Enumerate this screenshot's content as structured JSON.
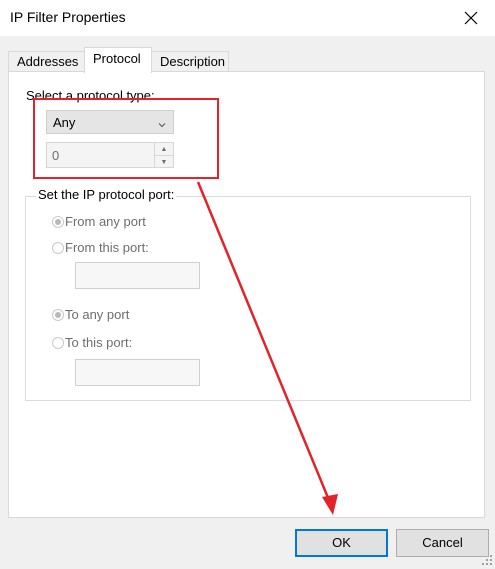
{
  "window": {
    "title": "IP Filter Properties",
    "close_icon": "close-icon"
  },
  "tabs": [
    {
      "label": "Addresses",
      "active": false
    },
    {
      "label": "Protocol",
      "active": true
    },
    {
      "label": "Description",
      "active": false
    }
  ],
  "protocol": {
    "type_label": "Select a protocol type:",
    "type_value": "Any",
    "number_value": "0"
  },
  "port_group": {
    "title": "Set the IP protocol port:",
    "from_any": "From any port",
    "from_this": "From this port:",
    "from_this_value": "",
    "to_any": "To any port",
    "to_this": "To this port:",
    "to_this_value": ""
  },
  "buttons": {
    "ok": "OK",
    "cancel": "Cancel"
  },
  "colors": {
    "annotation": "#e3232a",
    "focus": "#0078d7"
  }
}
